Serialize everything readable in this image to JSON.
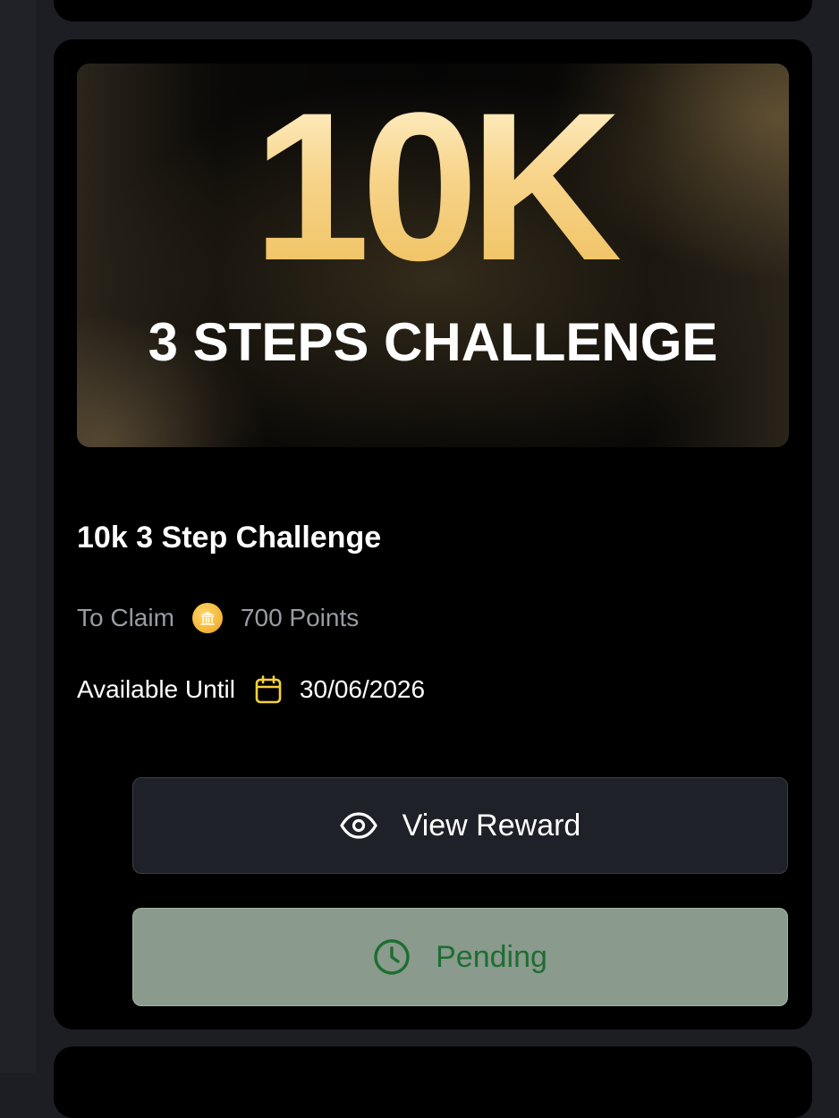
{
  "banner": {
    "headline": "10K",
    "subheadline": "3 STEPS CHALLENGE"
  },
  "reward": {
    "title": "10k 3 Step Challenge",
    "claim_label": "To Claim",
    "claim_icon": "coin-icon",
    "points": "700 Points",
    "until_label": "Available Until",
    "until_icon": "calendar-icon",
    "until_date": "30/06/2026"
  },
  "actions": {
    "view_label": "View Reward",
    "view_icon": "eye-icon",
    "status_label": "Pending",
    "status_icon": "clock-icon"
  },
  "colors": {
    "page_bg": "#1c1e23",
    "card_bg": "#000000",
    "gold": "#f3c76d",
    "calendar_yellow": "#f5d23a",
    "pending_bg": "#8a9a8d",
    "pending_text": "#1d6e31"
  }
}
